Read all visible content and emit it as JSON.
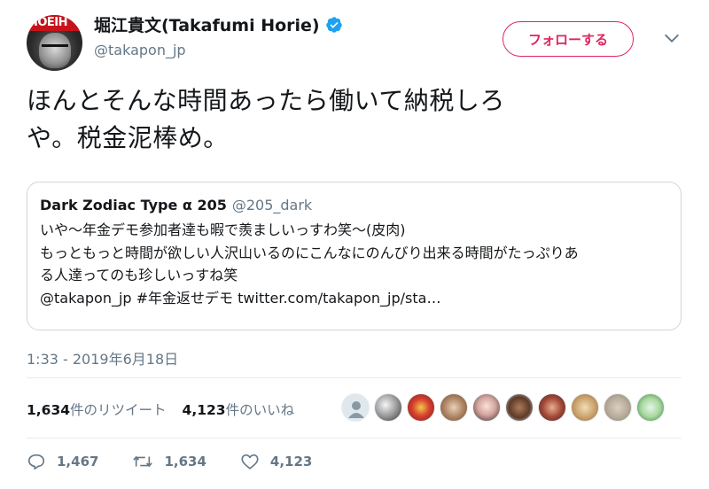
{
  "author": {
    "display_name": "堀江貴文(Takafumi Horie)",
    "handle": "@takapon_jp",
    "avatar_text": "HOEIH"
  },
  "follow_label": "フォローする",
  "tweet": {
    "line1": "ほんとそんな時間あったら働いて納税しろ",
    "line2": "や。税金泥棒め。"
  },
  "quoted": {
    "name": "Dark Zodiac Type α 205",
    "handle": "@205_dark",
    "lines": [
      "いや〜年金デモ参加者達も暇で羨ましいっすわ笑〜(皮肉)",
      "もっともっと時間が欲しい人沢山いるのにこんなにのんびり出来る時間がたっぷりあ",
      "る人達ってのも珍しいっすね笑",
      "@takapon_jp #年金返せデモ twitter.com/takapon_jp/sta…"
    ]
  },
  "timestamp": "1:33 - 2019年6月18日",
  "stats": {
    "retweets_count": "1,634",
    "retweets_label": "件のリツイート",
    "likes_count": "4,123",
    "likes_label": "件のいいね"
  },
  "actions": {
    "replies": "1,467",
    "retweets": "1,634",
    "likes": "4,123"
  },
  "colors": {
    "accent": "#e0245e",
    "verified": "#1da1f2",
    "muted": "#657786"
  },
  "liker_avatars": [
    "default",
    "cat",
    "flowers",
    "cartoon",
    "art",
    "anime",
    "photo",
    "figures",
    "landscape",
    "sticker"
  ]
}
